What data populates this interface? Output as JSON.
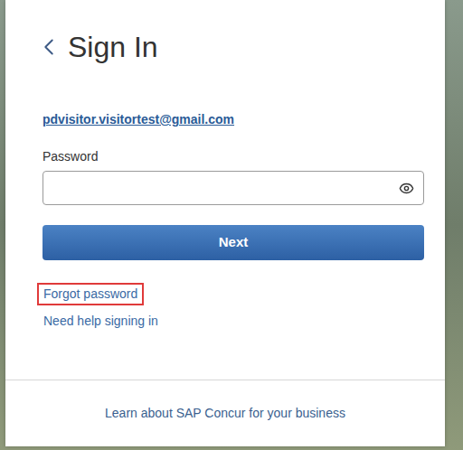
{
  "form": {
    "title": "Sign In",
    "email": "pdvisitor.visitortest@gmail.com",
    "password_label": "Password",
    "password_value": "",
    "button": "Next"
  },
  "links": [
    {
      "label": "Forgot password",
      "highlighted": true
    },
    {
      "label": "Need help signing in",
      "highlighted": false
    }
  ],
  "footer": {
    "link": "Learn about SAP Concur for your business"
  }
}
